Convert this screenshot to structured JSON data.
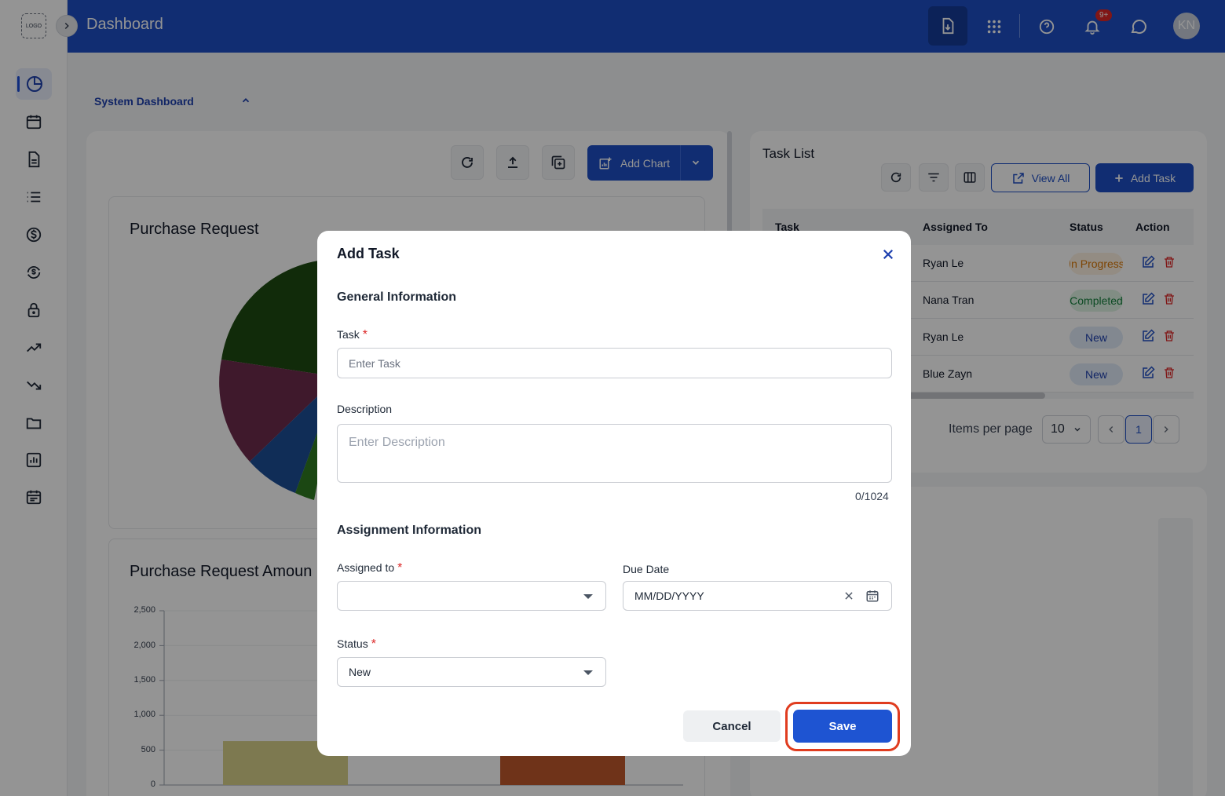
{
  "header": {
    "title": "Dashboard",
    "logo_text": "LOGO",
    "notification_count": "9+",
    "user_initials": "KN"
  },
  "sidebar": {
    "items": [
      {
        "name": "dashboard",
        "icon": "pie-chart-icon",
        "active": true
      },
      {
        "name": "calendar",
        "icon": "calendar-icon"
      },
      {
        "name": "document",
        "icon": "document-icon"
      },
      {
        "name": "list",
        "icon": "list-icon"
      },
      {
        "name": "finance",
        "icon": "dollar-icon"
      },
      {
        "name": "exchange",
        "icon": "currency-exchange-icon"
      },
      {
        "name": "security",
        "icon": "lock-icon"
      },
      {
        "name": "trending-up",
        "icon": "trending-up-icon"
      },
      {
        "name": "trending-down",
        "icon": "trending-down-icon"
      },
      {
        "name": "folder",
        "icon": "folder-icon"
      },
      {
        "name": "reports",
        "icon": "bar-chart-icon"
      },
      {
        "name": "schedule",
        "icon": "calendar-list-icon"
      }
    ]
  },
  "dashboard": {
    "section_title": "System Dashboard",
    "add_chart_label": "Add Chart",
    "card1_title": "Purchase Request",
    "card2_title": "Purchase Request Amoun",
    "y_axis_ticks": [
      "2,500",
      "2,000",
      "1,500",
      "1,000",
      "500",
      "0"
    ]
  },
  "chart_data": [
    {
      "type": "pie",
      "title": "Purchase Request",
      "slices": [
        {
          "color": "#1e4a12",
          "approx_share": 0.26
        },
        {
          "color": "#6d2c4c",
          "approx_share": 0.14
        },
        {
          "color": "#1d4e97",
          "approx_share": 0.08
        },
        {
          "color": "#2f7a22",
          "approx_share": 0.02
        }
      ]
    },
    {
      "type": "bar",
      "title": "Purchase Request Amoun",
      "ylim": [
        0,
        2500
      ],
      "yticks": [
        0,
        500,
        1000,
        1500,
        2000,
        2500
      ],
      "bars": [
        {
          "value": 630,
          "color": "#d7d08a"
        },
        {
          "value": 420,
          "color": "#c0582c"
        }
      ]
    }
  ],
  "task_list": {
    "title": "Task List",
    "view_all_label": "View All",
    "add_task_label": "Add Task",
    "columns": [
      "Task",
      "Assigned To",
      "Status",
      "Action"
    ],
    "rows": [
      {
        "assigned": "Ryan Le",
        "status": "In Progress",
        "status_color": "#d97706",
        "status_bg": "#fdf1e2"
      },
      {
        "assigned": "Nana Tran",
        "status": "Completed",
        "status_color": "#15803d",
        "status_bg": "#dff3e4"
      },
      {
        "assigned": "Ryan Le",
        "status": "New",
        "status_color": "#1e40af",
        "status_bg": "#e1ebf8"
      },
      {
        "assigned": "Blue Zayn",
        "status": "New",
        "status_color": "#1e40af",
        "status_bg": "#e1ebf8"
      }
    ],
    "items_per_page_label": "Items per page",
    "items_per_page_value": "10",
    "current_page": "1"
  },
  "modal": {
    "title": "Add Task",
    "general_section": "General Information",
    "task_label": "Task",
    "task_placeholder": "Enter Task",
    "description_label": "Description",
    "description_placeholder": "Enter Description",
    "description_counter": "0/1024",
    "assignment_section": "Assignment Information",
    "assigned_to_label": "Assigned to",
    "due_date_label": "Due Date",
    "due_date_placeholder": "MM/DD/YYYY",
    "status_label": "Status",
    "status_value": "New",
    "cancel_label": "Cancel",
    "save_label": "Save",
    "required_mark": "*"
  }
}
